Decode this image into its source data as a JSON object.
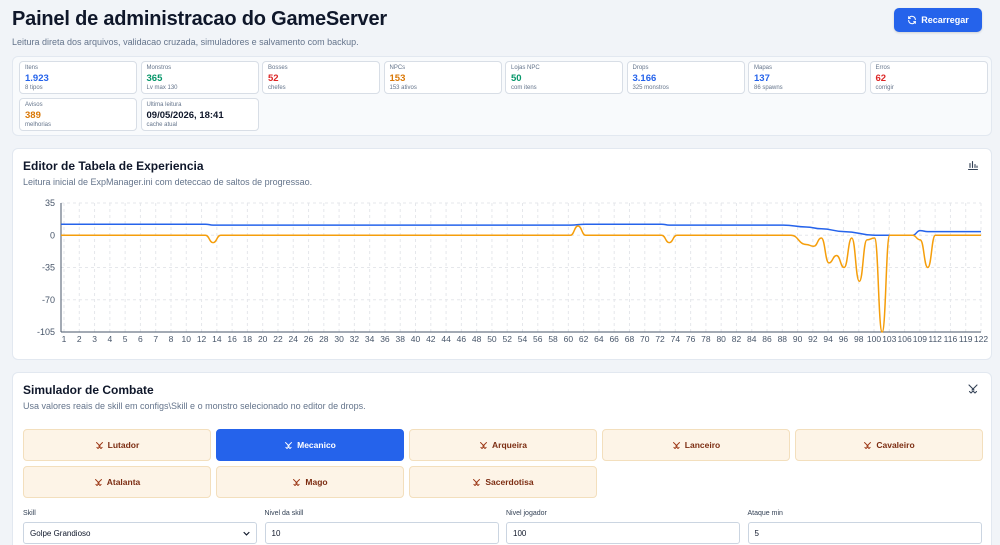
{
  "header": {
    "title": "Painel de administracao do GameServer",
    "subtitle": "Leitura direta dos arquivos, validacao cruzada, simuladores e salvamento com backup.",
    "reload_label": "Recarregar"
  },
  "stats": [
    {
      "label": "Itens",
      "value": "1.923",
      "sub": "8 tipos",
      "color": "#2563eb"
    },
    {
      "label": "Monstros",
      "value": "365",
      "sub": "Lv max 130",
      "color": "#059669"
    },
    {
      "label": "Bosses",
      "value": "52",
      "sub": "chefes",
      "color": "#dc2626"
    },
    {
      "label": "NPCs",
      "value": "153",
      "sub": "153 ativos",
      "color": "#d97706"
    },
    {
      "label": "Lojas NPC",
      "value": "50",
      "sub": "com itens",
      "color": "#059669"
    },
    {
      "label": "Drops",
      "value": "3.166",
      "sub": "325 monstros",
      "color": "#2563eb"
    },
    {
      "label": "Mapas",
      "value": "137",
      "sub": "86 spawns",
      "color": "#2563eb"
    },
    {
      "label": "Erros",
      "value": "62",
      "sub": "corrigir",
      "color": "#dc2626"
    },
    {
      "label": "Avisos",
      "value": "389",
      "sub": "melhorias",
      "color": "#d97706"
    },
    {
      "label": "Ultima leitura",
      "value": "09/05/2026, 18:41",
      "sub": "cache atual",
      "color": "#0f172a"
    }
  ],
  "exp_editor": {
    "title": "Editor de Tabela de Experiencia",
    "subtitle": "Leitura inicial de ExpManager.ini com deteccao de saltos de progressao.",
    "icon": "bar-chart-icon"
  },
  "chart_data": {
    "type": "line",
    "ylim": [
      -105,
      35
    ],
    "yticks": [
      35,
      0,
      -35,
      -70,
      -105
    ],
    "xlabels": [
      "1",
      "2",
      "3",
      "4",
      "5",
      "6",
      "7",
      "8",
      "10",
      "12",
      "14",
      "16",
      "18",
      "20",
      "22",
      "24",
      "26",
      "28",
      "30",
      "32",
      "34",
      "36",
      "38",
      "40",
      "42",
      "44",
      "46",
      "48",
      "50",
      "52",
      "54",
      "56",
      "58",
      "60",
      "62",
      "64",
      "66",
      "68",
      "70",
      "72",
      "74",
      "76",
      "78",
      "80",
      "82",
      "84",
      "86",
      "88",
      "90",
      "92",
      "94",
      "96",
      "98",
      "100",
      "103",
      "106",
      "109",
      "112",
      "116",
      "119",
      "122"
    ],
    "series": [
      {
        "color": "#2563eb",
        "points": [
          [
            1,
            12
          ],
          [
            20,
            12
          ],
          [
            21,
            11
          ],
          [
            68,
            11
          ],
          [
            70,
            12
          ],
          [
            80,
            12
          ],
          [
            81,
            11
          ],
          [
            96,
            11
          ],
          [
            99,
            9
          ],
          [
            101,
            7
          ],
          [
            104,
            4
          ],
          [
            108,
            0
          ],
          [
            113,
            0
          ],
          [
            114,
            5
          ],
          [
            115,
            4
          ],
          [
            122,
            4
          ]
        ]
      },
      {
        "color": "#f59e0b",
        "points": [
          [
            1,
            0
          ],
          [
            20,
            0
          ],
          [
            21,
            -8
          ],
          [
            22,
            0
          ],
          [
            68,
            0
          ],
          [
            69,
            10
          ],
          [
            70,
            0
          ],
          [
            80,
            0
          ],
          [
            81,
            -8
          ],
          [
            82,
            0
          ],
          [
            97,
            0
          ],
          [
            99,
            -10
          ],
          [
            100,
            -12
          ],
          [
            101,
            -3
          ],
          [
            102,
            -30
          ],
          [
            103,
            -22
          ],
          [
            104,
            -35
          ],
          [
            105,
            -3
          ],
          [
            106,
            -50
          ],
          [
            107,
            -5
          ],
          [
            108,
            -3
          ],
          [
            109,
            -105
          ],
          [
            110,
            0
          ],
          [
            113,
            0
          ],
          [
            114,
            -5
          ],
          [
            115,
            -35
          ],
          [
            116,
            0
          ],
          [
            122,
            0
          ]
        ]
      }
    ]
  },
  "combat": {
    "title": "Simulador de Combate",
    "subtitle": "Usa valores reais de skill em configs\\Skill e o monstro selecionado no editor de drops.",
    "icon": "crossed-swords-icon",
    "classes": [
      {
        "label": "Lutador",
        "active": false
      },
      {
        "label": "Mecanico",
        "active": true
      },
      {
        "label": "Arqueira",
        "active": false
      },
      {
        "label": "Lanceiro",
        "active": false
      },
      {
        "label": "Cavaleiro",
        "active": false
      },
      {
        "label": "Atalanta",
        "active": false
      },
      {
        "label": "Mago",
        "active": false
      },
      {
        "label": "Sacerdotisa",
        "active": false
      }
    ],
    "fields": [
      {
        "label": "Skill",
        "value": "Golpe Grandioso",
        "type": "select"
      },
      {
        "label": "Nivel da skill",
        "value": "10",
        "type": "input"
      },
      {
        "label": "Nivel jogador",
        "value": "100",
        "type": "input"
      },
      {
        "label": "Ataque min",
        "value": "5",
        "type": "input"
      }
    ]
  }
}
